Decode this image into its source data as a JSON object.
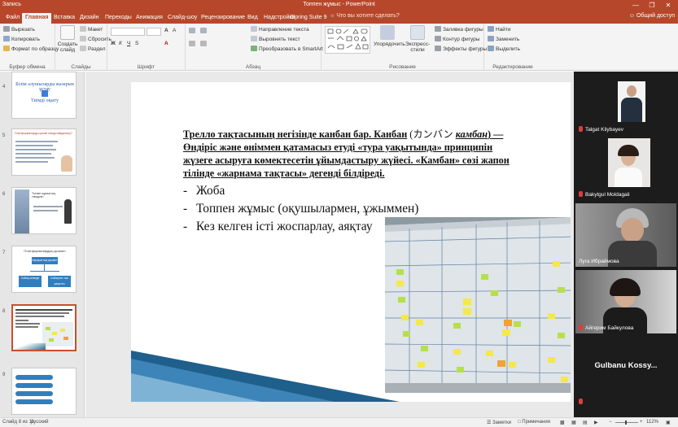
{
  "window": {
    "title": "Топпен жұмыс - PowerPoint",
    "autosave_label": "Запись",
    "controls": [
      "—",
      "❐",
      "✕"
    ]
  },
  "tabs": {
    "file": "Файл",
    "items": [
      "Главная",
      "Вставка",
      "Дизайн",
      "Переходы",
      "Анимация",
      "Слайд-шоу",
      "Рецензирование",
      "Вид",
      "Надстройки",
      "iSpring Suite 9"
    ],
    "tell_me": "Что вы хотите сделать?",
    "share": "Общий доступ"
  },
  "ribbon": {
    "clipboard": {
      "label": "Буфер обмена",
      "paste": "Вставить",
      "cut": "Вырезать",
      "copy": "Копировать",
      "format_painter": "Формат по образцу"
    },
    "slides": {
      "label": "Слайды",
      "new_slide": "Создать слайд",
      "layout": "Макет",
      "reset": "Сбросить",
      "section": "Раздел"
    },
    "font": {
      "label": "Шрифт",
      "font_name": "",
      "font_size": ""
    },
    "paragraph": {
      "label": "Абзац",
      "text_direction": "Направление текста",
      "align_text": "Выровнять текст",
      "smartart": "Преобразовать в SmartArt"
    },
    "drawing": {
      "label": "Рисование",
      "arrange": "Упорядочить",
      "quick_styles": "Экспресс-стили",
      "shape_fill": "Заливка фигуры",
      "shape_outline": "Контур фигуры",
      "shape_effects": "Эффекты фигуры"
    },
    "editing": {
      "label": "Редактирование",
      "find": "Найти",
      "replace": "Заменить",
      "select": "Выделить"
    }
  },
  "thumbnails": [
    {
      "num": "4",
      "title": "Білім алушыларды жазарын ұстау",
      "sub": "Тиімді оқыту"
    },
    {
      "num": "5",
      "title": "Платформаларды қалай тиімді пайдалану?"
    },
    {
      "num": "6",
      "title": "Топпен жұмыстың тиімділігі"
    },
    {
      "num": "7",
      "title": "Платформалардың қызметі",
      "box1": "Ақпараттық қызмет",
      "box2": "Сабақ кезінде",
      "box3": "Сабақтан тыс уақытта"
    },
    {
      "num": "8"
    },
    {
      "num": "9"
    }
  ],
  "slide": {
    "paragraph": {
      "seg1": "Трелло тақтасының негізінде канбан бар. Канбан",
      "seg2": " (カンバン ",
      "seg3": "камбан",
      "seg4": ") — Өндіріс және өніммен қатамасыз етуді «тура уақытында» принципін жүзеге асыруға көмектесетін ұйымдастыру жүйесі. «Камбан» сөзі жапон тілінде «жарнама тақтасы» дегенді білдіреді."
    },
    "bullets": [
      {
        "dash": "-",
        "text": "Жоба"
      },
      {
        "dash": "-",
        "text": "Топпен жұмыс (оқушылармен, ұжыммен)"
      },
      {
        "dash": "-",
        "text": "Кез келген істі жоспарлау, аяқтау"
      }
    ]
  },
  "participants": [
    {
      "name": "Talgat Kilybayev"
    },
    {
      "name": "Bakytgul Moldagali"
    },
    {
      "name": "Луга Ибраймова"
    },
    {
      "name": "Айгерим Байкулова"
    },
    {
      "name": "Gulbanu Kossy..."
    }
  ],
  "status": {
    "slide": "Слайд 8 из 11",
    "language": "русский",
    "notes": "Заметки",
    "comments": "Примечания",
    "zoom": "112%"
  },
  "colors": {
    "accent": "#b7472a",
    "selected": "#c8502d",
    "sticky_yellow": "#f4e84a",
    "sticky_green": "#b6e04a"
  }
}
